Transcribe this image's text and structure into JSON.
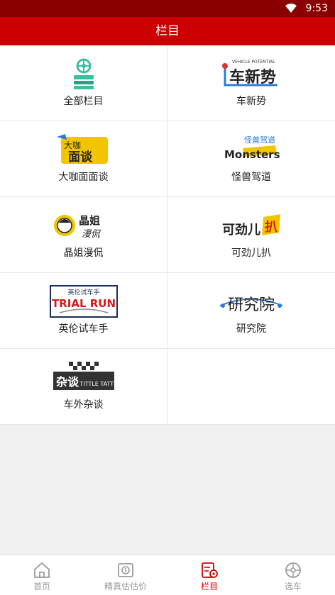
{
  "status": {
    "time": "9:53"
  },
  "header": {
    "title": "栏目"
  },
  "columns": [
    {
      "label": "全部栏目",
      "logo_text": ""
    },
    {
      "label": "车新势",
      "logo_text": "车新势",
      "logo_subtext": "VEHICLE POTENTIAL"
    },
    {
      "label": "大咖面面谈",
      "logo_text": "大咖面谈"
    },
    {
      "label": "怪兽驾道",
      "logo_text": "Monsters",
      "logo_subtext": "怪兽驾道"
    },
    {
      "label": "晶姐漫侃",
      "logo_text": "晶姐漫侃"
    },
    {
      "label": "可劲儿扒",
      "logo_text": "可劲儿扒"
    },
    {
      "label": "英伦试车手",
      "logo_text": "TRIAL RUN",
      "logo_subtext": "英伦试车手"
    },
    {
      "label": "研究院",
      "logo_text": "研究院"
    },
    {
      "label": "车外杂谈",
      "logo_text": "杂谈",
      "logo_subtext": "TITTLE TATTLE"
    }
  ],
  "tabs": [
    {
      "label": "首页",
      "icon": "home-icon"
    },
    {
      "label": "精真估估价",
      "icon": "car-price-icon"
    },
    {
      "label": "栏目",
      "icon": "column-settings-icon",
      "active": true
    },
    {
      "label": "选车",
      "icon": "wheel-icon"
    }
  ],
  "colors": {
    "brand_red": "#cc0000",
    "status_bar": "#8a0000",
    "teal": "#3bbfa3"
  }
}
